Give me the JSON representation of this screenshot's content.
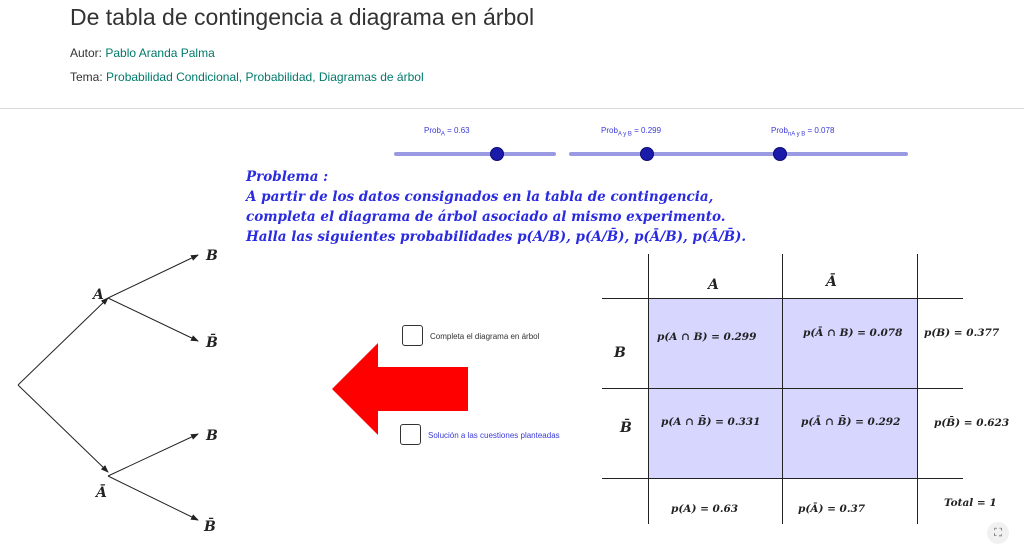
{
  "header": {
    "title": "De tabla de contingencia a diagrama en árbol",
    "author_label": "Autor:",
    "author": "Pablo Aranda Palma",
    "topic_label": "Tema:",
    "topics": [
      "Probabilidad Condicional",
      "Probabilidad",
      "Diagramas de árbol"
    ]
  },
  "sliders": [
    {
      "label": "Prob",
      "sub": "A",
      "value_text": " = 0.63",
      "value": 0.63
    },
    {
      "label": "Prob",
      "sub": "A y B",
      "value_text": " = 0.299",
      "value": 0.299
    },
    {
      "label": "Prob",
      "sub": "nA y B",
      "value_text": " = 0.078",
      "value": 0.078
    }
  ],
  "problem": {
    "heading": "Problema :",
    "lines": [
      "A partir de los datos consignados en la tabla de contingencia,",
      "completa el diagrama de árbol asociado al mismo experimento.",
      "Halla las siguientes probabilidades p(A/B), p(A/B̄), p(Ā/B), p(Ā/B̄)."
    ]
  },
  "tree": {
    "node_a": "A",
    "node_not_a": "Ā",
    "leaves": [
      "B",
      "B̄",
      "B",
      "B̄"
    ]
  },
  "controls": {
    "checkbox1_label": "Completa el diagrama en árbol",
    "checkbox1_checked": false,
    "checkbox2_label": "Solución a las cuestiones planteadas",
    "checkbox2_checked": false
  },
  "colors": {
    "accent": "#2a2ae0",
    "arrow": "#ff0000",
    "link": "#00796b",
    "table_fill": "#d6d6ff"
  },
  "table": {
    "col_headers": [
      "A",
      "Ā"
    ],
    "row_headers": [
      "B",
      "B̄"
    ],
    "cells": [
      [
        "p(A ∩ B) = 0.299",
        "p(Ā ∩ B) = 0.078"
      ],
      [
        "p(A ∩ B̄) = 0.331",
        "p(Ā ∩ B̄) = 0.292"
      ]
    ],
    "row_totals": [
      "p(B) = 0.377",
      "p(B̄) = 0.623"
    ],
    "col_totals": [
      "p(A) = 0.63",
      "p(Ā) = 0.37"
    ],
    "grand_total": "Total = 1"
  },
  "fullscreen_icon": "expand-icon"
}
